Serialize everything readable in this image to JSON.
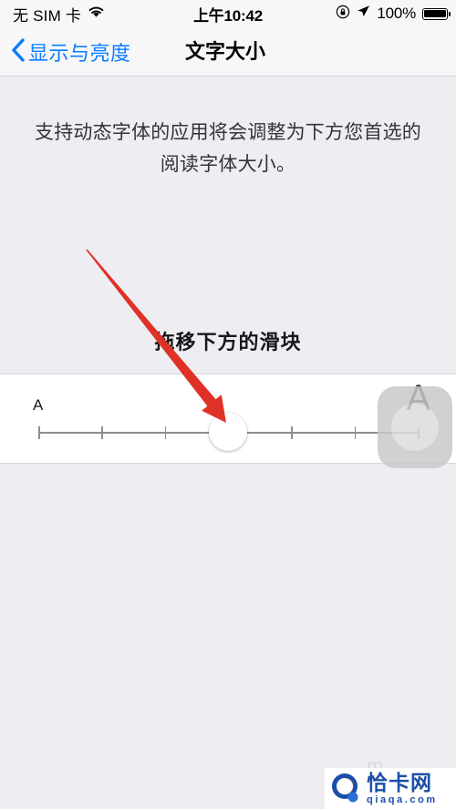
{
  "status_bar": {
    "carrier": "无 SIM 卡",
    "wifi_icon": "wifi-icon",
    "time": "上午10:42",
    "rotation_lock_icon": "rotation-lock-icon",
    "location_icon": "location-arrow-icon",
    "battery_percent": "100%",
    "battery_icon": "battery-full-icon"
  },
  "nav_bar": {
    "back_icon": "chevron-left-icon",
    "back_label": "显示与亮度",
    "title": "文字大小",
    "accent_color": "#0a7cff"
  },
  "content": {
    "description": "支持动态字体的应用将会调整为下方您首选的阅读字体大小。",
    "annotation": "拖移下方的滑块"
  },
  "slider": {
    "small_letter": "A",
    "large_letter": "A",
    "tick_count": 7,
    "selected_index": 3,
    "knob_name": "text-size-slider-knob",
    "arrow_color": "#e03127"
  },
  "watermark": {
    "ghost_text": "m",
    "brand_cn": "恰卡网",
    "brand_url": "qiaqa.com",
    "brand_color": "#1b4ea8"
  }
}
